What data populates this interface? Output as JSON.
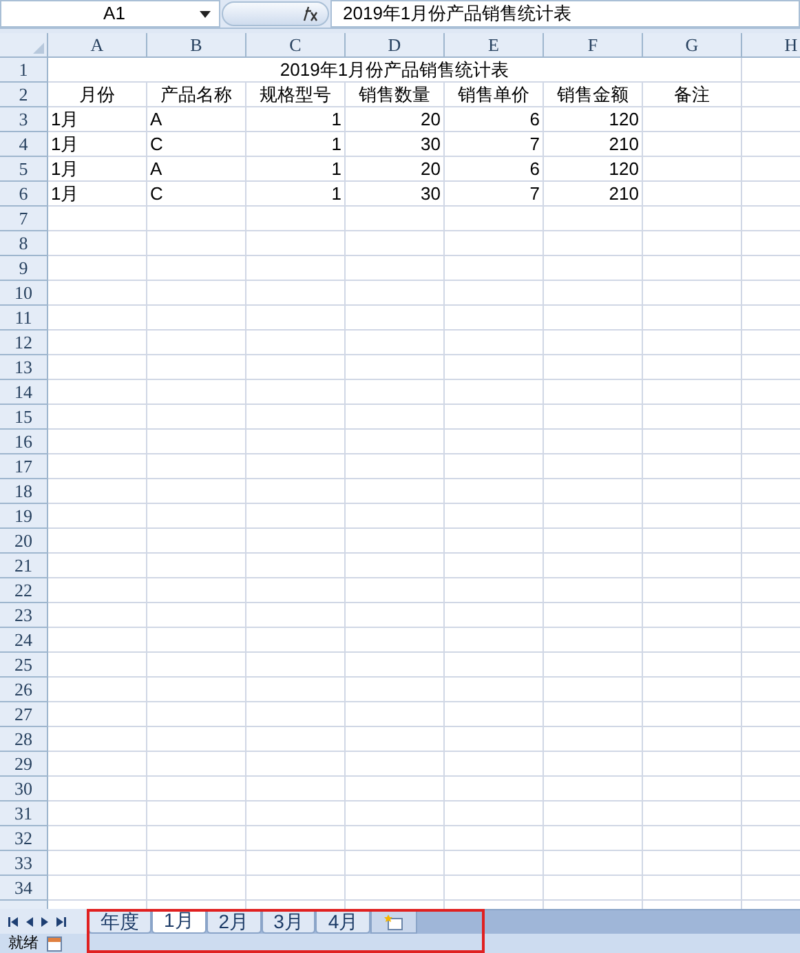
{
  "formula_bar": {
    "name_box": "A1",
    "formula": "2019年1月份产品销售统计表"
  },
  "columns": [
    {
      "label": "A",
      "numeric": false
    },
    {
      "label": "B",
      "numeric": false
    },
    {
      "label": "C",
      "numeric": true
    },
    {
      "label": "D",
      "numeric": true
    },
    {
      "label": "E",
      "numeric": true
    },
    {
      "label": "F",
      "numeric": true
    },
    {
      "label": "G"
    },
    {
      "label": "H"
    }
  ],
  "rows": [
    {
      "number": "1",
      "kind": "title",
      "cells": [
        "2019年1月份产品销售统计表"
      ]
    },
    {
      "number": "2",
      "kind": "header",
      "cells": [
        "月份",
        "产品名称",
        "规格型号",
        "销售数量",
        "销售单价",
        "销售金额",
        "备注"
      ]
    },
    {
      "number": "3",
      "kind": "data",
      "cells": [
        "1月",
        "A",
        "1",
        "20",
        "6",
        "120"
      ]
    },
    {
      "number": "4",
      "kind": "data",
      "cells": [
        "1月",
        "C",
        "1",
        "30",
        "7",
        "210"
      ]
    },
    {
      "number": "5",
      "kind": "data",
      "cells": [
        "1月",
        "A",
        "1",
        "20",
        "6",
        "120"
      ]
    },
    {
      "number": "6",
      "kind": "data",
      "cells": [
        "1月",
        "C",
        "1",
        "30",
        "7",
        "210"
      ]
    },
    {
      "number": "7",
      "kind": "empty"
    },
    {
      "number": "8",
      "kind": "empty"
    },
    {
      "number": "9",
      "kind": "empty"
    },
    {
      "number": "10",
      "kind": "empty"
    },
    {
      "number": "11",
      "kind": "empty"
    },
    {
      "number": "12",
      "kind": "empty"
    },
    {
      "number": "13",
      "kind": "empty"
    },
    {
      "number": "14",
      "kind": "empty"
    },
    {
      "number": "15",
      "kind": "empty"
    },
    {
      "number": "16",
      "kind": "empty"
    },
    {
      "number": "17",
      "kind": "empty"
    },
    {
      "number": "18",
      "kind": "empty"
    },
    {
      "number": "19",
      "kind": "empty"
    },
    {
      "number": "20",
      "kind": "empty"
    },
    {
      "number": "21",
      "kind": "empty"
    },
    {
      "number": "22",
      "kind": "empty"
    },
    {
      "number": "23",
      "kind": "empty"
    },
    {
      "number": "24",
      "kind": "empty"
    },
    {
      "number": "25",
      "kind": "empty"
    },
    {
      "number": "26",
      "kind": "empty"
    },
    {
      "number": "27",
      "kind": "empty"
    },
    {
      "number": "28",
      "kind": "empty"
    },
    {
      "number": "29",
      "kind": "empty"
    },
    {
      "number": "30",
      "kind": "empty"
    },
    {
      "number": "31",
      "kind": "empty"
    },
    {
      "number": "32",
      "kind": "empty"
    },
    {
      "number": "33",
      "kind": "empty"
    },
    {
      "number": "34",
      "kind": "empty"
    }
  ],
  "sheet_tabs": [
    {
      "label": "年度",
      "selected": false
    },
    {
      "label": "1月",
      "selected": true
    },
    {
      "label": "2月",
      "selected": false
    },
    {
      "label": "3月",
      "selected": false
    },
    {
      "label": "4月",
      "selected": false
    }
  ],
  "status_bar": {
    "text": "就绪"
  }
}
